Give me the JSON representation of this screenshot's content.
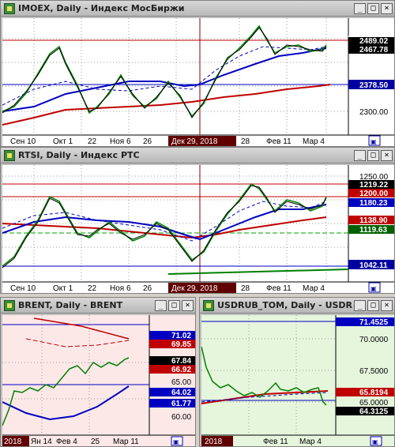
{
  "windows": [
    {
      "title": "IMOEX, Daily - Индекс МосБиржи",
      "xticks": [
        "Сен 10",
        "Окт 1",
        "22",
        "Ноя 6",
        "26",
        "Дек 29, 2018",
        "28",
        "Фев 11",
        "Мар 4"
      ],
      "y_levels": [
        "2489.02",
        "2467.78",
        "2378.50",
        "2300.00"
      ],
      "cursor_label": "Дек 29, 2018"
    },
    {
      "title": "RTSI, Daily - Индекс РТС",
      "xticks": [
        "Сен 10",
        "Окт 1",
        "22",
        "Ноя 6",
        "26",
        "Дек 29, 2018",
        "28",
        "Фев 11",
        "Мар 4"
      ],
      "y_levels": [
        "1250.00",
        "1219.22",
        "1200.00",
        "1180.23",
        "1138.90",
        "1119.63",
        "1042.11"
      ],
      "cursor_label": "Дек 29, 2018"
    },
    {
      "title": "BRENT, Daily - BRENT",
      "xticks": [
        "2018",
        "Ян 14",
        "Фев 4",
        "25",
        "Мар 11"
      ],
      "y_levels": [
        "71.02",
        "69.85",
        "67.84",
        "66.92",
        "65.00",
        "64.02",
        "61.77",
        "60.00"
      ]
    },
    {
      "title": "USDRUB_TOM, Daily - USDR",
      "xticks": [
        "2018",
        "Фев 11",
        "Мар 4"
      ],
      "y_levels": [
        "71.4525",
        "70.0000",
        "67.5000",
        "65.8194",
        "65.0000",
        "64.3125"
      ]
    }
  ],
  "buttons": {
    "minimize": "_",
    "maximize": "□",
    "close": "×"
  }
}
